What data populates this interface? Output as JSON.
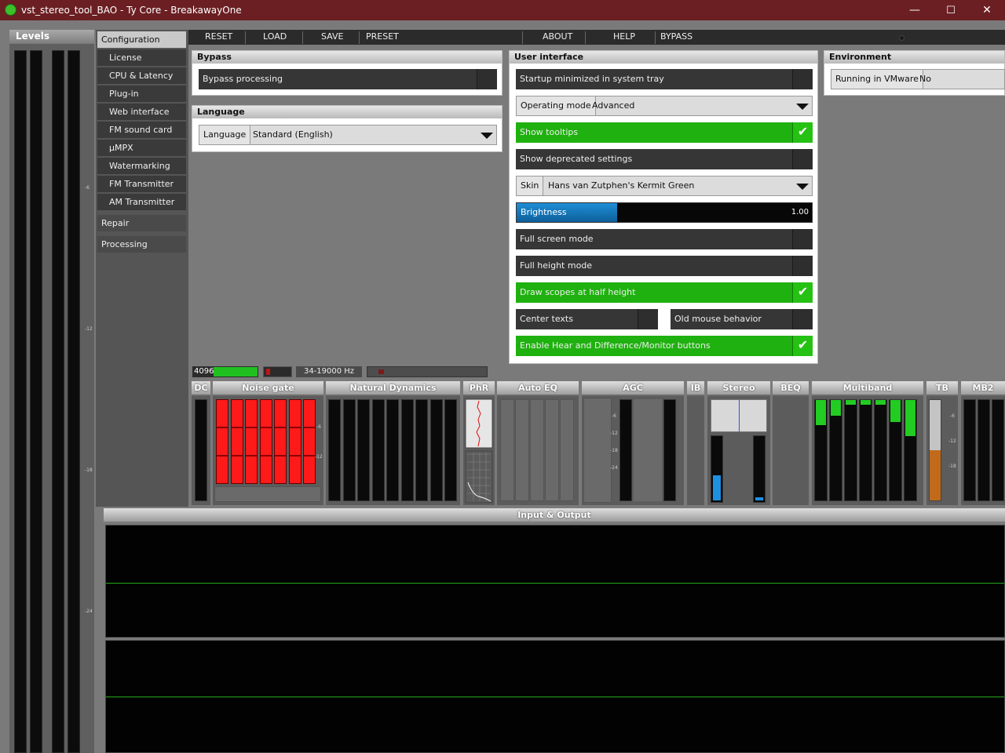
{
  "window": {
    "title": "vst_stereo_tool_BAO - Ty Core - BreakawayOne",
    "minimize": "—",
    "maximize": "☐",
    "close": "✕"
  },
  "levels": {
    "label": "Levels",
    "scale": [
      "-6",
      "-12",
      "-18",
      "-24"
    ]
  },
  "nav": {
    "configuration": "Configuration",
    "items": [
      "License",
      "CPU & Latency",
      "Plug-in",
      "Web interface",
      "FM sound card",
      "µMPX",
      "Watermarking",
      "FM Transmitter",
      "AM Transmitter"
    ],
    "repair": "Repair",
    "processing": "Processing"
  },
  "toolbar": {
    "reset": "RESET",
    "load": "LOAD",
    "save": "SAVE",
    "preset": "PRESET",
    "about": "ABOUT",
    "help": "HELP",
    "bypass": "BYPASS"
  },
  "bypass_panel": {
    "title": "Bypass",
    "bypass_processing": "Bypass processing"
  },
  "language_panel": {
    "title": "Language",
    "label": "Language",
    "value": "Standard (English)"
  },
  "ui_panel": {
    "title": "User interface",
    "startup_minimized": "Startup minimized in system tray",
    "operating_mode_label": "Operating mode",
    "operating_mode_value": "Advanced",
    "show_tooltips": "Show tooltips",
    "show_deprecated": "Show deprecated settings",
    "skin_label": "Skin",
    "skin_value": "Hans van Zutphen's Kermit Green",
    "brightness_label": "Brightness",
    "brightness_value": "1.00",
    "brightness_level": 0.34,
    "full_screen": "Full screen mode",
    "full_height": "Full height mode",
    "draw_scopes": "Draw scopes at half height",
    "center_texts": "Center texts",
    "old_mouse": "Old mouse behavior",
    "enable_hear": "Enable Hear and Difference/Monitor buttons",
    "check_glyph": "✔"
  },
  "environment_panel": {
    "title": "Environment",
    "running_vmware_label": "Running in VMware",
    "running_vmware_value": "No"
  },
  "status": {
    "buffer": "4096",
    "freq_range": "34-19000 Hz"
  },
  "modules": {
    "dc": "DC",
    "noise_gate": "Noise gate",
    "natural_dynamics": "Natural Dynamics",
    "phr": "PhR",
    "auto_eq": "Auto EQ",
    "agc": "AGC",
    "ib": "IB",
    "stereo": "Stereo",
    "beq": "BEQ",
    "multiband": "Multiband",
    "tb": "TB",
    "mb2": "MB2",
    "scale": [
      "-6",
      "-12",
      "-18",
      "-24"
    ]
  },
  "io": {
    "title": "Input & Output"
  },
  "colors": {
    "titlebar": "#6b1f22",
    "toggle_on": "#1fb10f",
    "brightness": "#1f8ed6",
    "gate": "#ff1a1a",
    "multiband": "#22cc22",
    "tb": "#c06a1a",
    "stereo": "#1e90e0"
  }
}
